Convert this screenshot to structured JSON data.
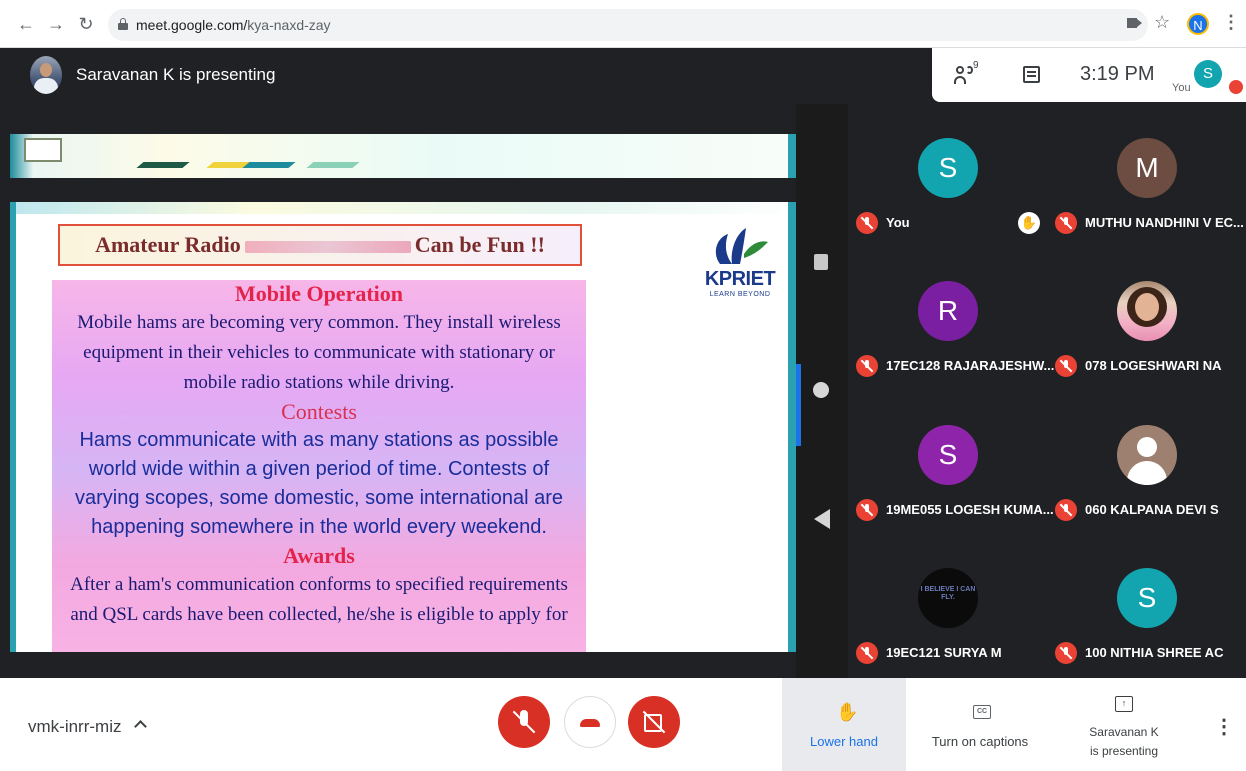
{
  "browser": {
    "url_host": "meet.google.com/",
    "url_path": "kya-naxd-zay",
    "profile_initial": "N"
  },
  "header": {
    "presenting_title": "Saravanan K is presenting",
    "participant_count": "9",
    "time": "3:19 PM",
    "self_label": "You",
    "self_initial": "S"
  },
  "slide": {
    "heading_left": "Amateur Radio",
    "heading_right": "Can be Fun  !!",
    "logo_name": "KPRIET",
    "logo_tagline": "LEARN BEYOND",
    "mobile_title": "Mobile Operation",
    "mobile_lines": [
      "Mobile hams are becoming very common. They install wireless",
      "equipment in their vehicles to communicate with stationary or",
      "mobile radio stations while driving."
    ],
    "contests_title": "Contests",
    "contests_lines": [
      "Hams communicate with as many stations as possible",
      "world wide within a given period of time. Contests of",
      "varying scopes, some domestic, some international are",
      "happening somewhere in the world every weekend."
    ],
    "awards_title": "Awards",
    "awards_lines": [
      "After a ham's communication conforms to specified requirements",
      "and QSL cards have been collected, he/she is eligible to apply for"
    ]
  },
  "participants": [
    {
      "name": "You",
      "initial": "S",
      "color": "#12a4af",
      "hand_raised": true
    },
    {
      "name": "MUTHU NANDHINI V EC...",
      "initial": "M",
      "color": "#6d4c41"
    },
    {
      "name": "17EC128 RAJARAJESHW...",
      "initial": "R",
      "color": "#7b1fa2"
    },
    {
      "name": "078 LOGESHWARI NA",
      "initial": "",
      "photo": "girl-photo"
    },
    {
      "name": "19ME055 LOGESH KUMA...",
      "initial": "S",
      "color": "#8e24aa"
    },
    {
      "name": "060 KALPANA DEVI S",
      "initial": "",
      "photo": "default-avatar"
    },
    {
      "name": "19EC121 SURYA M",
      "initial": "",
      "photo": "text-image",
      "photo_text": "I BELIEVE I CAN FLY."
    },
    {
      "name": "100 NITHIA SHREE AC",
      "initial": "S",
      "color": "#12a4af"
    }
  ],
  "bottom": {
    "meeting_code": "vmk-inrr-miz",
    "lower_hand": "Lower hand",
    "captions": "Turn on captions",
    "cc_glyph": "CC",
    "presenting_line1": "Saravanan K",
    "presenting_line2": "is presenting"
  },
  "colors": {
    "accent": "#1a73e8",
    "danger": "#d93025",
    "background": "#202124"
  }
}
